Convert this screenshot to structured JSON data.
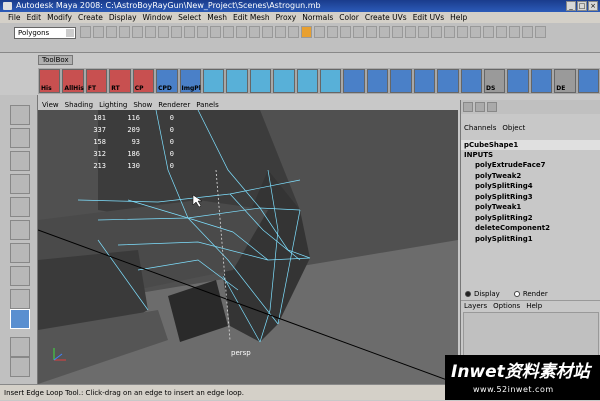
{
  "window": {
    "title": "Autodesk Maya 2008: C:\\AstroBoyRayGun\\New_Project\\Scenes\\Astrogun.mb"
  },
  "menubar": [
    "File",
    "Edit",
    "Modify",
    "Create",
    "Display",
    "Window",
    "Select",
    "Mesh",
    "Edit Mesh",
    "Proxy",
    "Normals",
    "Color",
    "Create UVs",
    "Edit UVs",
    "Help"
  ],
  "status": {
    "mode": "Polygons"
  },
  "shelf": {
    "tab": "ToolBox",
    "items": [
      "His",
      "AllHis",
      "FT",
      "RT",
      "CP",
      "CPD",
      "ImgPl",
      "",
      "",
      "",
      "",
      "",
      "",
      "",
      "",
      "",
      "",
      "",
      "",
      "DS",
      "",
      "",
      "DE",
      "",
      ""
    ]
  },
  "panel_menu": [
    "View",
    "Shading",
    "Lighting",
    "Show",
    "Renderer",
    "Panels"
  ],
  "hud": {
    "rows": [
      [
        "181",
        "116",
        "0"
      ],
      [
        "337",
        "209",
        "0"
      ],
      [
        "158",
        "93",
        "0"
      ],
      [
        "312",
        "186",
        "0"
      ],
      [
        "213",
        "130",
        "0"
      ]
    ]
  },
  "viewport": {
    "camera": "persp"
  },
  "channel_box": {
    "menu": [
      "Channels",
      "Object"
    ],
    "shape": "pCubeShape1",
    "inputs_label": "INPUTS",
    "inputs": [
      "polyExtrudeFace7",
      "polyTweak2",
      "polySplitRing4",
      "polySplitRing3",
      "polyTweak1",
      "polySplitRing2",
      "deleteComponent2",
      "polySplitRing1"
    ]
  },
  "layer_editor": {
    "radio_display": "Display",
    "radio_render": "Render",
    "menu": [
      "Layers",
      "Options",
      "Help"
    ]
  },
  "help_line": "Insert Edge Loop Tool.: Click-drag on an edge to insert an edge loop.",
  "watermark": {
    "title": "Inwet资料素材站",
    "url": "www.52inwet.com"
  },
  "colors": {
    "title_bar": "#1a3c8c",
    "viewport_bg": "#7a7a7a",
    "wireframe": "#7fe0ff"
  }
}
